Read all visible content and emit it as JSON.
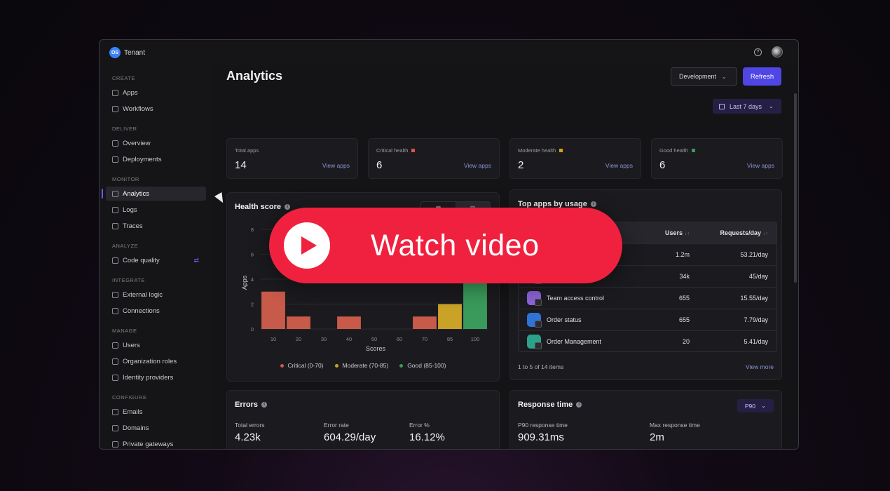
{
  "tenant": {
    "logo": "OS",
    "name": "Tenant"
  },
  "header_icons": {
    "help": "help-icon",
    "avatar": "avatar"
  },
  "sidebar": {
    "sections": [
      {
        "title": "CREATE",
        "items": [
          {
            "label": "Apps",
            "icon": "apps-icon"
          },
          {
            "label": "Workflows",
            "icon": "workflows-icon"
          }
        ]
      },
      {
        "title": "DELIVER",
        "items": [
          {
            "label": "Overview",
            "icon": "overview-icon"
          },
          {
            "label": "Deployments",
            "icon": "deployments-icon"
          }
        ]
      },
      {
        "title": "MONITOR",
        "items": [
          {
            "label": "Analytics",
            "icon": "analytics-icon",
            "active": true
          },
          {
            "label": "Logs",
            "icon": "logs-icon"
          },
          {
            "label": "Traces",
            "icon": "traces-icon"
          }
        ]
      },
      {
        "title": "ANALYZE",
        "items": [
          {
            "label": "Code quality",
            "icon": "code-quality-icon",
            "extra": "⇄"
          }
        ]
      },
      {
        "title": "INTEGRATE",
        "items": [
          {
            "label": "External logic",
            "icon": "external-logic-icon"
          },
          {
            "label": "Connections",
            "icon": "connections-icon"
          }
        ]
      },
      {
        "title": "MANAGE",
        "items": [
          {
            "label": "Users",
            "icon": "users-icon"
          },
          {
            "label": "Organization roles",
            "icon": "roles-icon"
          },
          {
            "label": "Identity providers",
            "icon": "identity-icon"
          }
        ]
      },
      {
        "title": "CONFIGURE",
        "items": [
          {
            "label": "Emails",
            "icon": "emails-icon"
          },
          {
            "label": "Domains",
            "icon": "domains-icon"
          },
          {
            "label": "Private gateways",
            "icon": "gateways-icon"
          }
        ]
      }
    ]
  },
  "page": {
    "title": "Analytics",
    "environment": "Development",
    "refresh_label": "Refresh",
    "date_filter": "Last 7 days"
  },
  "stats": [
    {
      "label": "Total apps",
      "value": "14",
      "link": "View apps",
      "color": ""
    },
    {
      "label": "Critical health",
      "value": "6",
      "link": "View apps",
      "color": "#d9534f"
    },
    {
      "label": "Moderate health",
      "value": "2",
      "link": "View apps",
      "color": "#d4a017"
    },
    {
      "label": "Good health",
      "value": "6",
      "link": "View apps",
      "color": "#3a9a5b"
    }
  ],
  "health_score": {
    "title": "Health score",
    "chart_data": {
      "type": "bar",
      "categories": [
        "10",
        "20",
        "30",
        "40",
        "50",
        "60",
        "70",
        "85",
        "100"
      ],
      "values": [
        3,
        1,
        0,
        1,
        0,
        0,
        1,
        2,
        4
      ],
      "colors": [
        "#c85a4a",
        "#c85a4a",
        "#c85a4a",
        "#c85a4a",
        "#c85a4a",
        "#c85a4a",
        "#c85a4a",
        "#c9a227",
        "#3a9a5b"
      ],
      "xlabel": "Scores",
      "ylabel": "Apps",
      "yticks": [
        "0",
        "2",
        "4",
        "6",
        "8"
      ],
      "ylim": [
        0,
        8
      ],
      "legend": [
        {
          "label": "Critical (0-70)",
          "color": "#c85a4a"
        },
        {
          "label": "Moderate (70-85)",
          "color": "#c9a227"
        },
        {
          "label": "Good (85-100)",
          "color": "#3a9a5b"
        }
      ]
    }
  },
  "top_apps": {
    "title": "Top apps by usage",
    "columns": {
      "users": "Users",
      "requests": "Requests/day"
    },
    "rows": [
      {
        "name": "",
        "users": "1.2m",
        "requests": "53.21/day",
        "icon_color": "#6b4fd8"
      },
      {
        "name": "",
        "users": "34k",
        "requests": "45/day",
        "icon_color": "#2d6ad8"
      },
      {
        "name": "Team access control",
        "users": "655",
        "requests": "15.55/day",
        "icon_color": "#8e63d9"
      },
      {
        "name": "Order status",
        "users": "655",
        "requests": "7.79/day",
        "icon_color": "#2f73d6"
      },
      {
        "name": "Order Management",
        "users": "20",
        "requests": "5.41/day",
        "icon_color": "#2aa38a"
      }
    ],
    "count_text": "1 to 5 of 14 items",
    "view_more": "View more"
  },
  "errors": {
    "title": "Errors",
    "metrics": [
      {
        "label": "Total errors",
        "value": "4.23k"
      },
      {
        "label": "Error rate",
        "value": "604.29/day"
      },
      {
        "label": "Error %",
        "value": "16.12%"
      }
    ]
  },
  "response_time": {
    "title": "Response time",
    "percentile": "P90",
    "metrics": [
      {
        "label": "P90 response time",
        "value": "909.31ms"
      },
      {
        "label": "Max response time",
        "value": "2m"
      }
    ]
  },
  "video_overlay": {
    "label": "Watch video"
  }
}
